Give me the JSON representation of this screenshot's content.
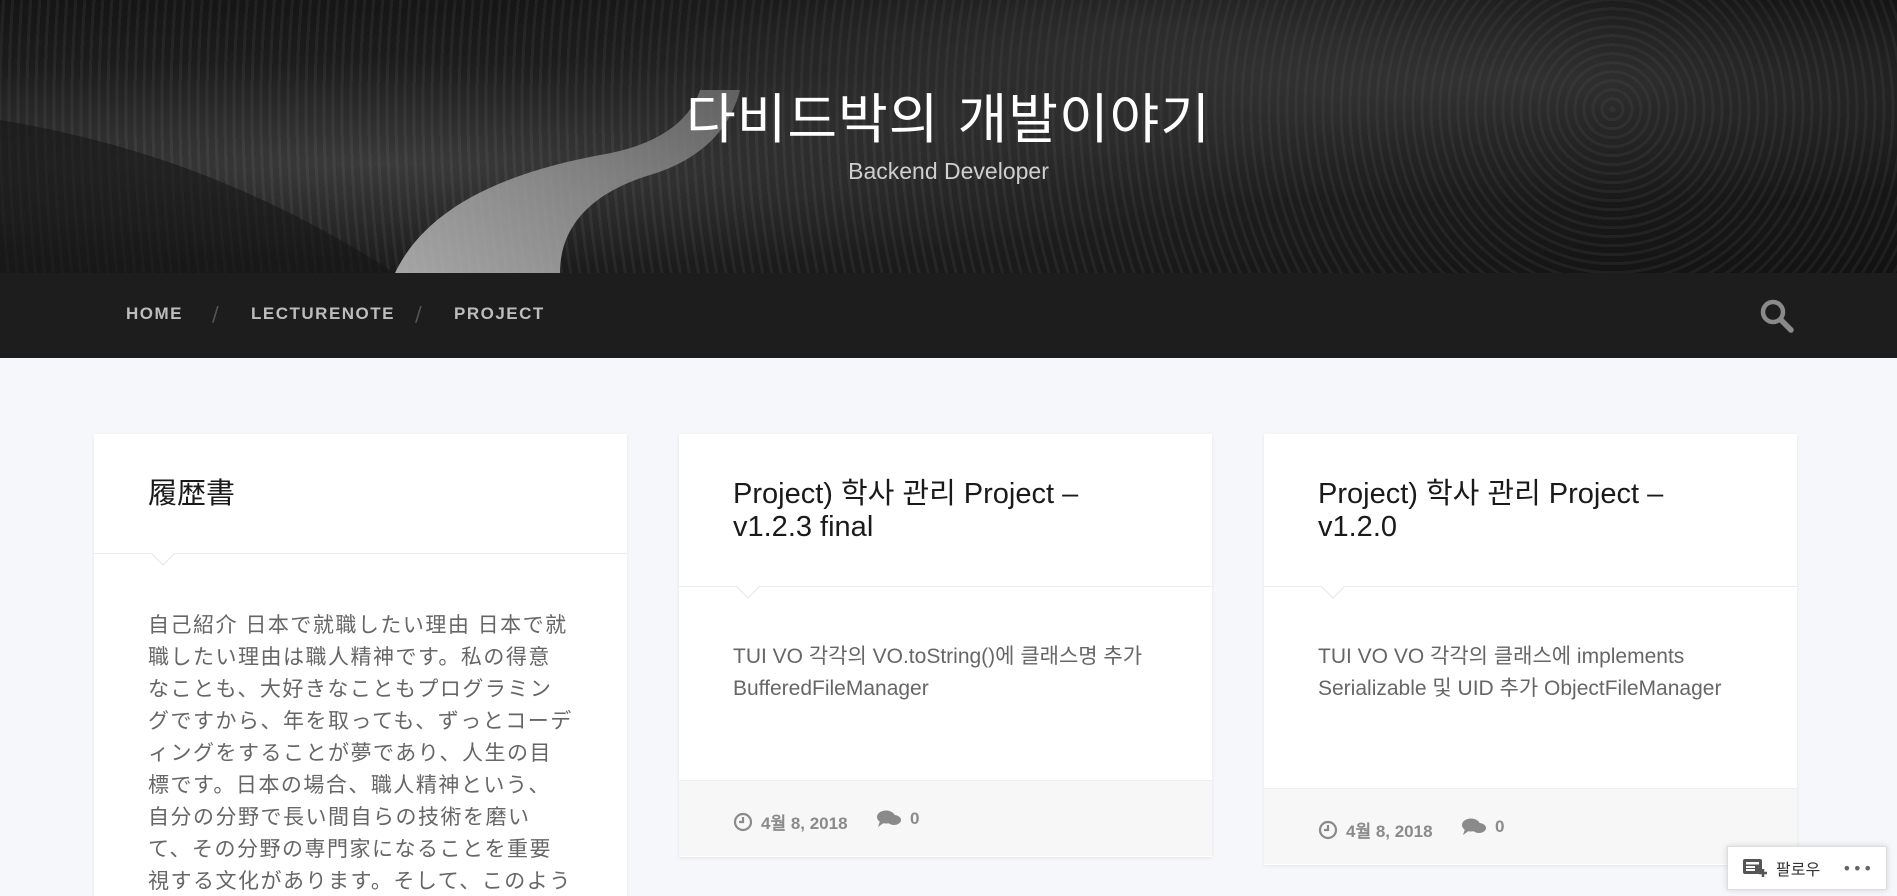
{
  "site": {
    "title": "다비드박의 개발이야기",
    "tagline": "Backend Developer"
  },
  "nav": {
    "items": [
      {
        "label": "HOME"
      },
      {
        "label": "LECTURENOTE"
      },
      {
        "label": "PROJECT"
      }
    ],
    "separator": "/",
    "search_icon": "search-icon"
  },
  "cards": [
    {
      "title": "履歴書",
      "excerpt": "自己紹介 日本で就職したい理由 日本で就職したい理由は職人精神です。私の得意なことも、大好きなこともプログラミングですから、年を取っても、ずっとコーディングをすることが夢であり、人生の目標です。日本の場合、職人精神という、自分の分野で長い間自らの技術を磨いて、その分野の専門家になることを重要視する文化があります。そして、このように専門家を尊敬す"
    },
    {
      "title": "Project) 학사 관리 Project – v1.2.3 final",
      "excerpt": "TUI VO 각각의 VO.toString()에 클래스명 추가 BufferedFileManager",
      "date": "4월 8, 2018",
      "comments": "0"
    },
    {
      "title": "Project) 학사 관리 Project – v1.2.0",
      "excerpt": "TUI VO VO 각각의 클래스에 implements Serializable 및 UID 추가 ObjectFileManager",
      "date": "4월 8, 2018",
      "comments": "0"
    }
  ],
  "follow": {
    "label": "팔로우",
    "more": "•••"
  },
  "colors": {
    "navbar": "#1d1d1d",
    "page_bg": "#f6f7fb",
    "card_bg": "#ffffff"
  }
}
